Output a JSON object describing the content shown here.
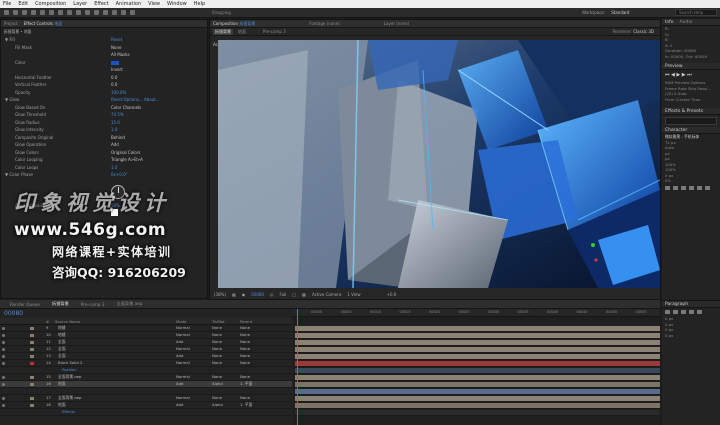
{
  "menu": [
    "File",
    "Edit",
    "Composition",
    "Layer",
    "Effect",
    "Animation",
    "View",
    "Window",
    "Help"
  ],
  "toolbar": {
    "snapping": "Snapping",
    "workspace_label": "Workspace:",
    "workspace_value": "Standard",
    "search_placeholder": "Search Help"
  },
  "project_panel": {
    "tabs": [
      "Project",
      "Effect Controls"
    ],
    "layer_tab": "地面",
    "breadcrumb": "拆镜背景 • 地面"
  },
  "effect_controls": {
    "rows": [
      {
        "name": "▼ Fill",
        "value": "Reset",
        "link": true
      },
      {
        "name": "Fill Mask",
        "value": "None"
      },
      {
        "name": "",
        "value": "All Masks"
      },
      {
        "name": "Color",
        "value": ""
      },
      {
        "name": "",
        "value": "Invert"
      },
      {
        "name": "Horizontal Feather",
        "value": "0.0"
      },
      {
        "name": "Vertical Feather",
        "value": "0.0"
      },
      {
        "name": "Opacity",
        "value": "100.0%",
        "link": true
      },
      {
        "name": "▼ Glow",
        "value": "Reset   Options...   About...",
        "link": true
      },
      {
        "name": "Glow Based On",
        "value": "Color Channels"
      },
      {
        "name": "Glow Threshold",
        "value": "74.5%",
        "link": true
      },
      {
        "name": "Glow Radius",
        "value": "15.0",
        "link": true
      },
      {
        "name": "Glow Intensity",
        "value": "1.0",
        "link": true
      },
      {
        "name": "Composite Original",
        "value": "Behind"
      },
      {
        "name": "Glow Operation",
        "value": "Add"
      },
      {
        "name": "Glow Colors",
        "value": "Original Colors"
      },
      {
        "name": "Color Looping",
        "value": "Triangle A>B>A"
      },
      {
        "name": "Color Loops",
        "value": "1.0",
        "link": true
      },
      {
        "name": "▼ Color Phase",
        "value": "0x+0.0°",
        "link": true
      }
    ],
    "midpoint": {
      "name": "A & B Midpoint",
      "value": "50%"
    }
  },
  "watermark": {
    "line1": "印象视觉设计",
    "line2": "www.546g.com",
    "line3": "网络课程+实体培训",
    "line4": "咨询QQ: 916206209"
  },
  "composition_panel": {
    "tabs": [
      "Composition",
      "Footage (none)",
      "Layer (none)"
    ],
    "comp_name": "拆镜背景",
    "sub_tab": "拆镜背景",
    "sub_tab2": "地面",
    "precomp": "Pre-comp 3",
    "active_camera": "Active Camera",
    "renderer": "Renderer:",
    "renderer_value": "Classic 3D"
  },
  "viewer_bar": {
    "zoom": "(38%)",
    "timecode": "00080",
    "quality": "Full",
    "camera": "Active Camera",
    "view": "1 View",
    "offset": "+0.0"
  },
  "right_panel": {
    "info_tab": "Info",
    "audio_tab": "Audio",
    "info_lines": [
      "R:",
      "G:",
      "B:",
      "A: 0"
    ],
    "info_extra": [
      "Duration: 00060",
      "In: 00000, Out: 00059"
    ],
    "preview_tab": "Preview",
    "preview_lines": [
      "RAM Preview Options",
      "Frame Rate  Skip  Resol...",
      "(25)  0  Auto",
      "From Current Time"
    ],
    "effects_tab": "Effects & Presets",
    "character_tab": "Character",
    "character_font": "微软雅黑 - 手机标体",
    "character_lines": [
      "72 px",
      "Auto",
      "px",
      "px",
      "100%",
      "100%",
      "0 px",
      "0%"
    ]
  },
  "timeline": {
    "tabs": [
      "Render Queue",
      "拆镜背景",
      "Pre-comp 3",
      "全面背景.aep"
    ],
    "active_tab": "拆镜背景",
    "time": "00080",
    "col_headers": {
      "num": "#",
      "source": "Source Name",
      "mode": "Mode",
      "trkmat": "TrkMat",
      "parent": "Parent"
    },
    "layers": [
      {
        "num": "9",
        "name": "地缝",
        "mode": "Normal",
        "trk": "None",
        "parent": "None",
        "color": "#8a8070",
        "bar": "#8b8275"
      },
      {
        "num": "10",
        "name": "地缝",
        "mode": "Normal",
        "trk": "None",
        "parent": "None",
        "color": "#8a8070",
        "bar": "#8b8275"
      },
      {
        "num": "11",
        "name": "全面",
        "mode": "Add",
        "trk": "None",
        "parent": "None",
        "color": "#8a8070",
        "bar": "#8b8275"
      },
      {
        "num": "12",
        "name": "全面",
        "mode": "Normal",
        "trk": "None",
        "parent": "None",
        "color": "#8a8070",
        "bar": "#8b8275"
      },
      {
        "num": "13",
        "name": "全面",
        "mode": "Add",
        "trk": "None",
        "parent": "None",
        "color": "#8a8070",
        "bar": "#8b8275"
      },
      {
        "num": "14",
        "name": "Black Solid 2",
        "mode": "Normal",
        "trk": "None",
        "parent": "None",
        "color": "#c03030",
        "bar": "#9a3a3a"
      },
      {
        "num": "",
        "name": "Position",
        "mode": "",
        "trk": "",
        "parent": "",
        "color": "",
        "bar": "#3a4a5a"
      },
      {
        "num": "15",
        "name": "全面背景.aep",
        "mode": "Normal",
        "trk": "None",
        "parent": "None",
        "color": "#8a8070",
        "bar": "#8b8275"
      },
      {
        "num": "16",
        "name": "地面",
        "mode": "Add",
        "trk": "Alpha",
        "parent": "1. 平面",
        "color": "#8a8070",
        "bar": "#7d7468"
      },
      {
        "num": "",
        "name": "",
        "mode": "",
        "trk": "",
        "parent": "",
        "color": "",
        "bar": "#5a6a8a"
      },
      {
        "num": "17",
        "name": "全面背景.aep",
        "mode": "Normal",
        "trk": "None",
        "parent": "None",
        "color": "#8a8070",
        "bar": "#8b8275"
      },
      {
        "num": "18",
        "name": "地面",
        "mode": "Add",
        "trk": "Alpha",
        "parent": "1. 平面",
        "color": "#8a8070",
        "bar": "#7d7468"
      },
      {
        "num": "",
        "name": "Effects",
        "mode": "",
        "trk": "",
        "parent": "",
        "color": "",
        "bar": "#2a2a2a"
      }
    ],
    "ruler": [
      "00000",
      "00005",
      "00010",
      "00015",
      "00020",
      "00025",
      "00030",
      "00035",
      "00040",
      "00045",
      "00050",
      "00055"
    ]
  },
  "paragraph_panel": {
    "tab": "Paragraph",
    "lines": [
      "0 px",
      "0 px",
      "0 px",
      "0 px"
    ]
  }
}
